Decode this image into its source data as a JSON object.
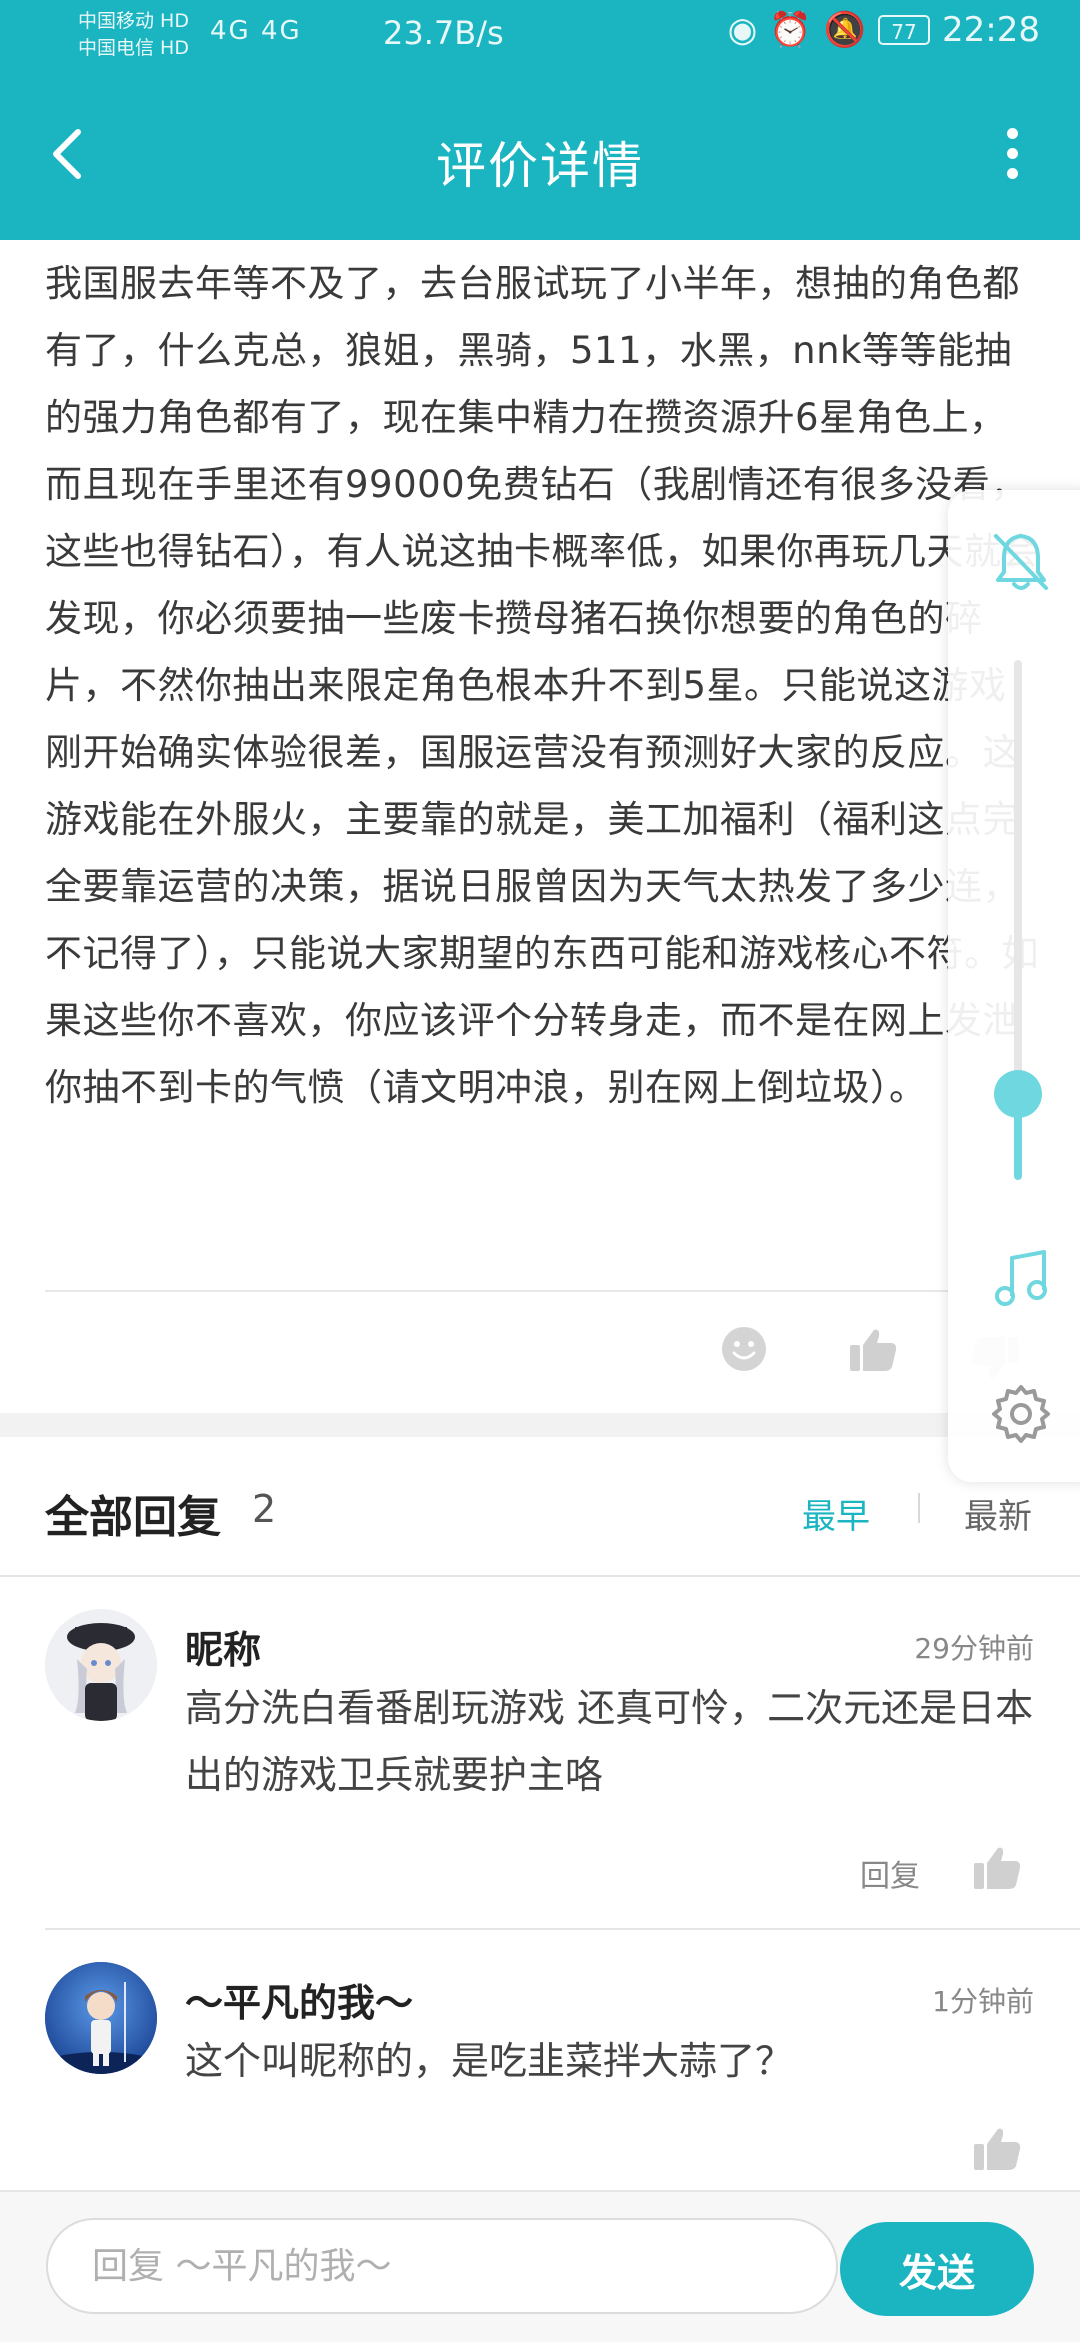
{
  "status_bar": {
    "carrier1": "中国移动 HD",
    "carrier2": "中国电信 HD",
    "signal": "4G 4G",
    "net_speed": "23.7B/s",
    "battery": "77",
    "time": "22:28"
  },
  "app_bar": {
    "title": "评价详情",
    "back_icon": "chevron-left-icon",
    "more_icon": "more-vertical-icon"
  },
  "review": {
    "text": "我国服去年等不及了，去台服试玩了小半年，想抽的角色都有了，什么克总，狼姐，黑骑，511，水黑，nnk等等能抽的强力角色都有了，现在集中精力在攒资源升6星角色上，而且现在手里还有99000免费钻石（我剧情还有很多没看，这些也得钻石），有人说这抽卡概率低，如果你再玩几天就会发现，你必须要抽一些废卡攒母猪石换你想要的角色的碎片，不然你抽出来限定角色根本升不到5星。只能说这游戏刚开始确实体验很差，国服运营没有预测好大家的反应。这游戏能在外服火，主要靠的就是，美工加福利（福利这点完全要靠运营的决策，据说日服曾因为天气太热发了多少连，不记得了），只能说大家期望的东西可能和游戏核心不符。如果这些你不喜欢，你应该评个分转身走，而不是在网上发泄你抽不到卡的气愤（请文明冲浪，别在网上倒垃圾）。"
  },
  "replies": {
    "title": "全部回复",
    "count": "2",
    "sort_earliest": "最早",
    "sort_latest": "最新",
    "reply_label": "回复",
    "items": [
      {
        "name": "昵称",
        "time": "29分钟前",
        "text": "高分洗白看番剧玩游戏 还真可怜，二次元还是日本出的游戏卫兵就要护主咯"
      },
      {
        "name": "～平凡的我～",
        "time": "1分钟前",
        "text": "这个叫昵称的，是吃韭菜拌大蒜了？"
      }
    ]
  },
  "input_bar": {
    "placeholder": "回复 ～平凡的我～",
    "send_label": "发送"
  },
  "colors": {
    "accent": "#1ab5c1",
    "floating_accent": "#6fd7df"
  },
  "float_panel": {
    "icons": [
      "bell-off-icon",
      "music-note-icon",
      "gear-icon"
    ],
    "slider_level": 0.17
  }
}
